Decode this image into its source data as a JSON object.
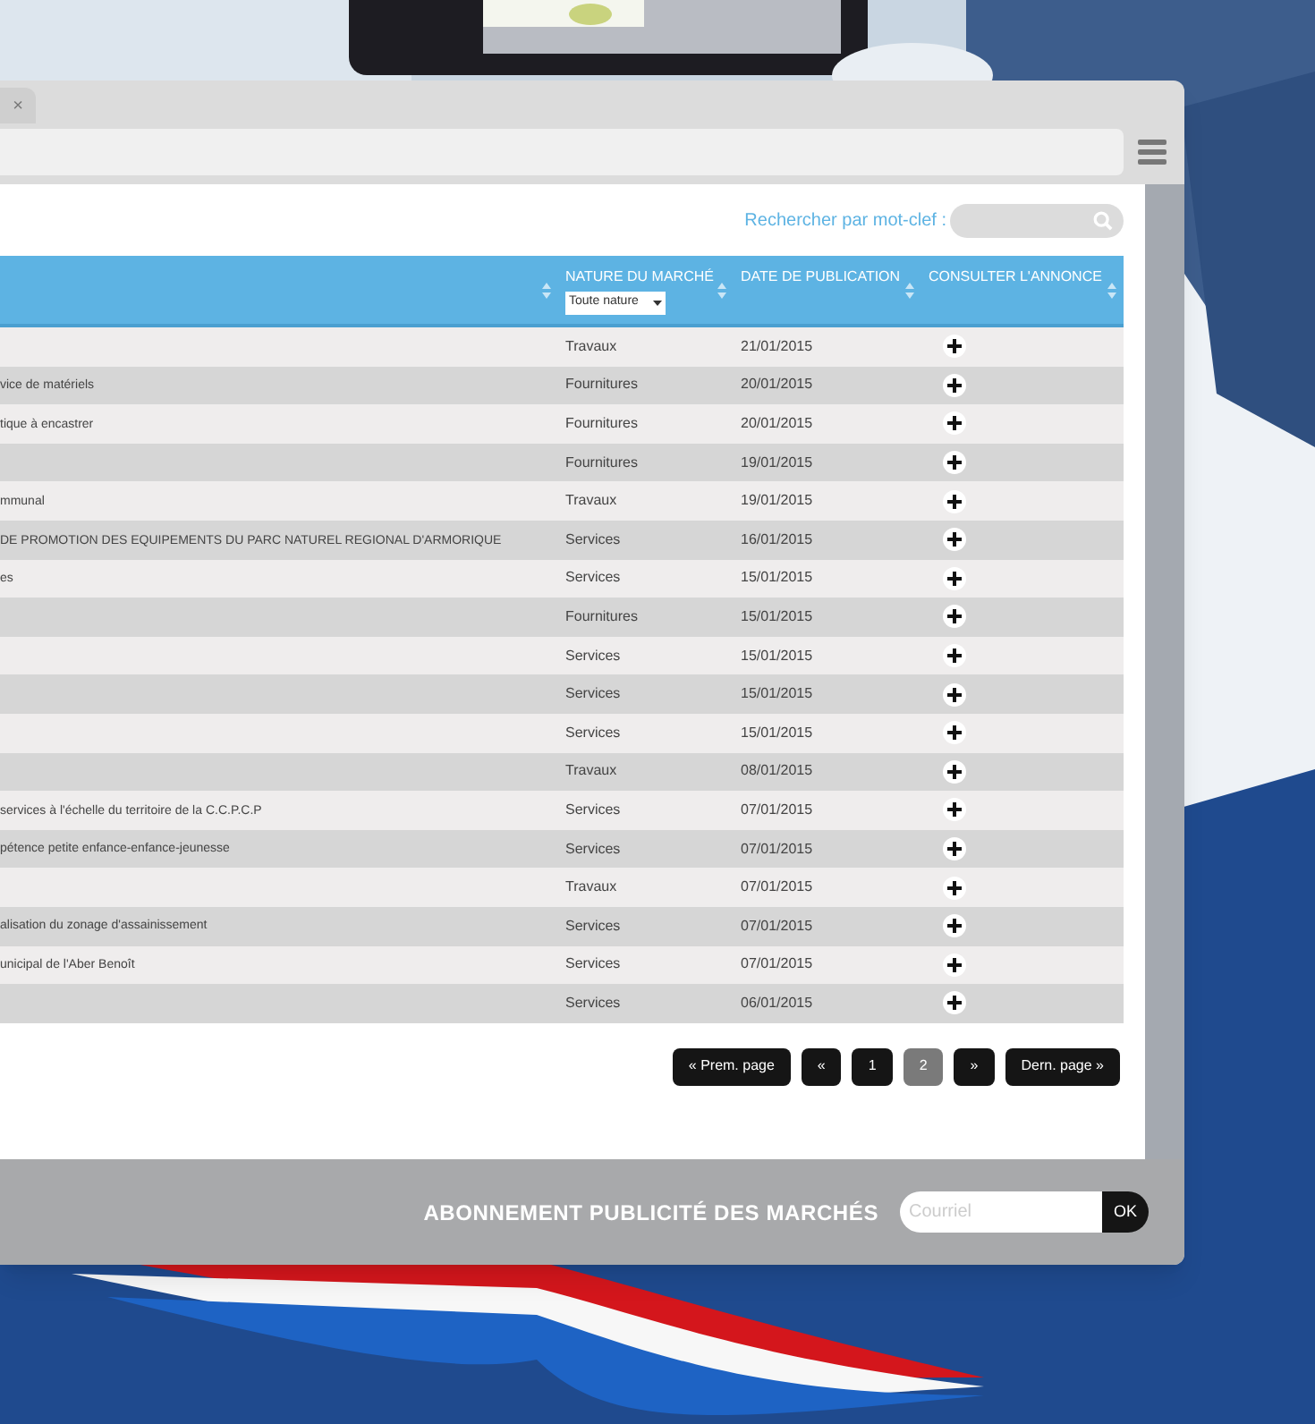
{
  "browser": {
    "tab_close": "×"
  },
  "search": {
    "label": "Rechercher par mot-clef :"
  },
  "table": {
    "columns": [
      {
        "kind": "blank"
      },
      {
        "kind": "filter",
        "label": "NATURE DU MARCHÉ",
        "filter": "Toute nature"
      },
      {
        "kind": "text",
        "label": "DATE DE PUBLICATION"
      },
      {
        "kind": "text",
        "label": "CONSULTER L'ANNONCE"
      }
    ],
    "rows": [
      {
        "nature": "Travaux",
        "date": "21/01/2015"
      },
      {
        "object": "vice de matériels",
        "nature": "Fournitures",
        "date": "20/01/2015"
      },
      {
        "object": "tique à encastrer",
        "nature": "Fournitures",
        "date": "20/01/2015"
      },
      {
        "nature": "Fournitures",
        "date": "19/01/2015"
      },
      {
        "object": "mmunal",
        "nature": "Travaux",
        "date": "19/01/2015"
      },
      {
        "object": "DE PROMOTION DES EQUIPEMENTS DU PARC NATUREL REGIONAL D'ARMORIQUE",
        "nature": "Services",
        "date": "16/01/2015"
      },
      {
        "object": "es",
        "nature": "Services",
        "date": "15/01/2015"
      },
      {
        "nature": "Fournitures",
        "date": "15/01/2015"
      },
      {
        "nature": "Services",
        "date": "15/01/2015"
      },
      {
        "nature": "Services",
        "date": "15/01/2015"
      },
      {
        "nature": "Services",
        "date": "15/01/2015"
      },
      {
        "nature": "Travaux",
        "date": "08/01/2015"
      },
      {
        "object": "services à l'échelle du territoire de la C.C.P.C.P",
        "nature": "Services",
        "date": "07/01/2015"
      },
      {
        "object": "pétence petite enfance-enfance-jeunesse",
        "nature": "Services",
        "date": "07/01/2015"
      },
      {
        "nature": "Travaux",
        "date": "07/01/2015"
      },
      {
        "object": "alisation du zonage d'assainissement",
        "nature": "Services",
        "date": "07/01/2015"
      },
      {
        "object": "unicipal de l'Aber Benoît",
        "nature": "Services",
        "date": "07/01/2015"
      },
      {
        "nature": "Services",
        "date": "06/01/2015"
      }
    ]
  },
  "pagination": [
    {
      "label": "« Prem. page",
      "selected": false
    },
    {
      "label": "«",
      "selected": false
    },
    {
      "label": "1",
      "selected": false
    },
    {
      "label": "2",
      "selected": true
    },
    {
      "label": "»",
      "selected": false
    },
    {
      "label": "Dern. page »",
      "selected": false
    }
  ],
  "footer": {
    "title": "ABONNEMENT PUBLICITÉ DES MARCHÉS",
    "email_placeholder": "Courriel",
    "submit": "OK"
  }
}
